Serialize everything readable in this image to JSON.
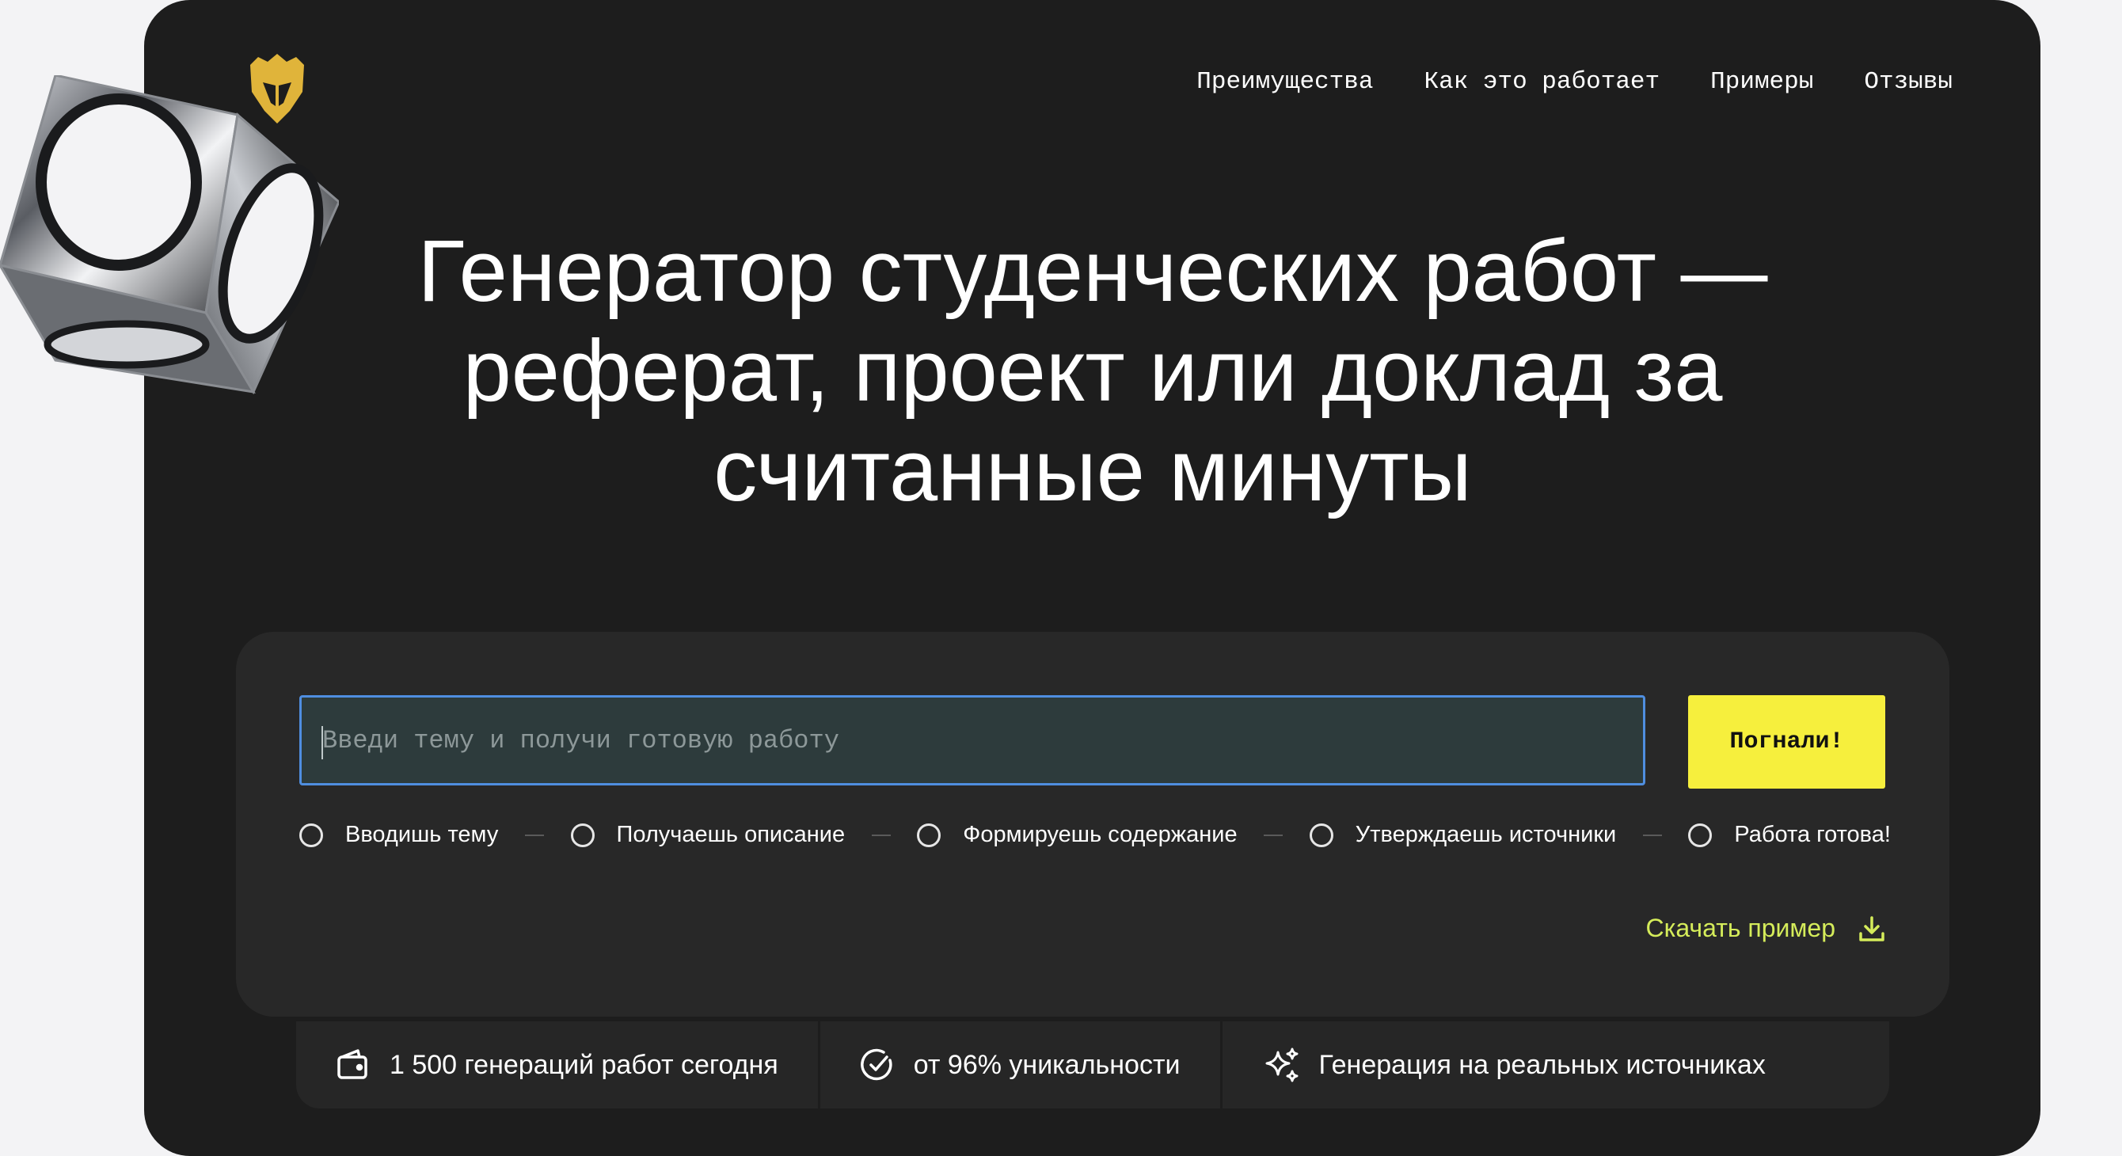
{
  "nav": {
    "items": [
      "Преимущества",
      "Как это работает",
      "Примеры",
      "Отзывы"
    ]
  },
  "hero": {
    "line1": "Генератор студенческих работ —",
    "line2": "реферат, проект или доклад за",
    "line3": "считанные минуты"
  },
  "search": {
    "placeholder": "Введи тему и получи готовую работу",
    "value": ""
  },
  "cta": {
    "label": "Погнали!"
  },
  "steps": [
    "Вводишь тему",
    "Получаешь описание",
    "Формируешь содержание",
    "Утверждаешь источники",
    "Работа готова!"
  ],
  "download": {
    "label": "Скачать пример",
    "icon": "download-icon"
  },
  "stats": [
    {
      "icon": "wallet-icon",
      "text": "1 500 генераций работ сегодня"
    },
    {
      "icon": "check-circle-icon",
      "text": "от 96% уникальности"
    },
    {
      "icon": "sparkles-icon",
      "text": "Генерация на реальных источниках"
    }
  ],
  "colors": {
    "background": "#1d1d1d",
    "panel": "#282828",
    "accent": "#f6ef3d",
    "link": "#d5ec5a",
    "input_border": "#4f8ee0",
    "logo": "#e0b43a"
  }
}
